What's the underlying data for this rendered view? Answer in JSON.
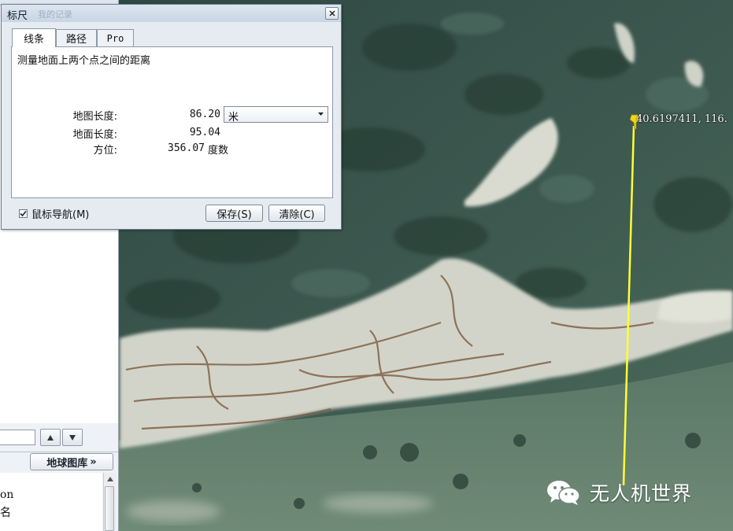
{
  "dialog": {
    "title": "标尺",
    "title_ghost": "我的记录",
    "tabs": [
      {
        "label": "线条",
        "active": true
      },
      {
        "label": "路径",
        "active": false
      },
      {
        "label": "Pro",
        "active": false
      }
    ],
    "description": "测量地面上两个点之间的距离",
    "map_length_label": "地图长度:",
    "map_length_value": "86.20",
    "ground_length_label": "地面长度:",
    "ground_length_value": "95.04",
    "heading_label": "方位:",
    "heading_value": "356.07",
    "heading_unit": "度数",
    "unit_selected": "米",
    "mouse_nav_label": "鼠标导航(M)",
    "mouse_nav_checked": true,
    "save_label": "保存(S)",
    "clear_label": "清除(C)"
  },
  "sidebar": {
    "gallery_button": "地球图库",
    "gallery_chevron": "»",
    "layer_items": [
      "on",
      "名"
    ]
  },
  "map": {
    "placemark_coord": "40.6197411, 116.",
    "measure_line_color": "#ffff33",
    "pin_color": "#f3d51a"
  },
  "watermark": {
    "text": "无人机世界",
    "icon": "wechat-icon"
  }
}
